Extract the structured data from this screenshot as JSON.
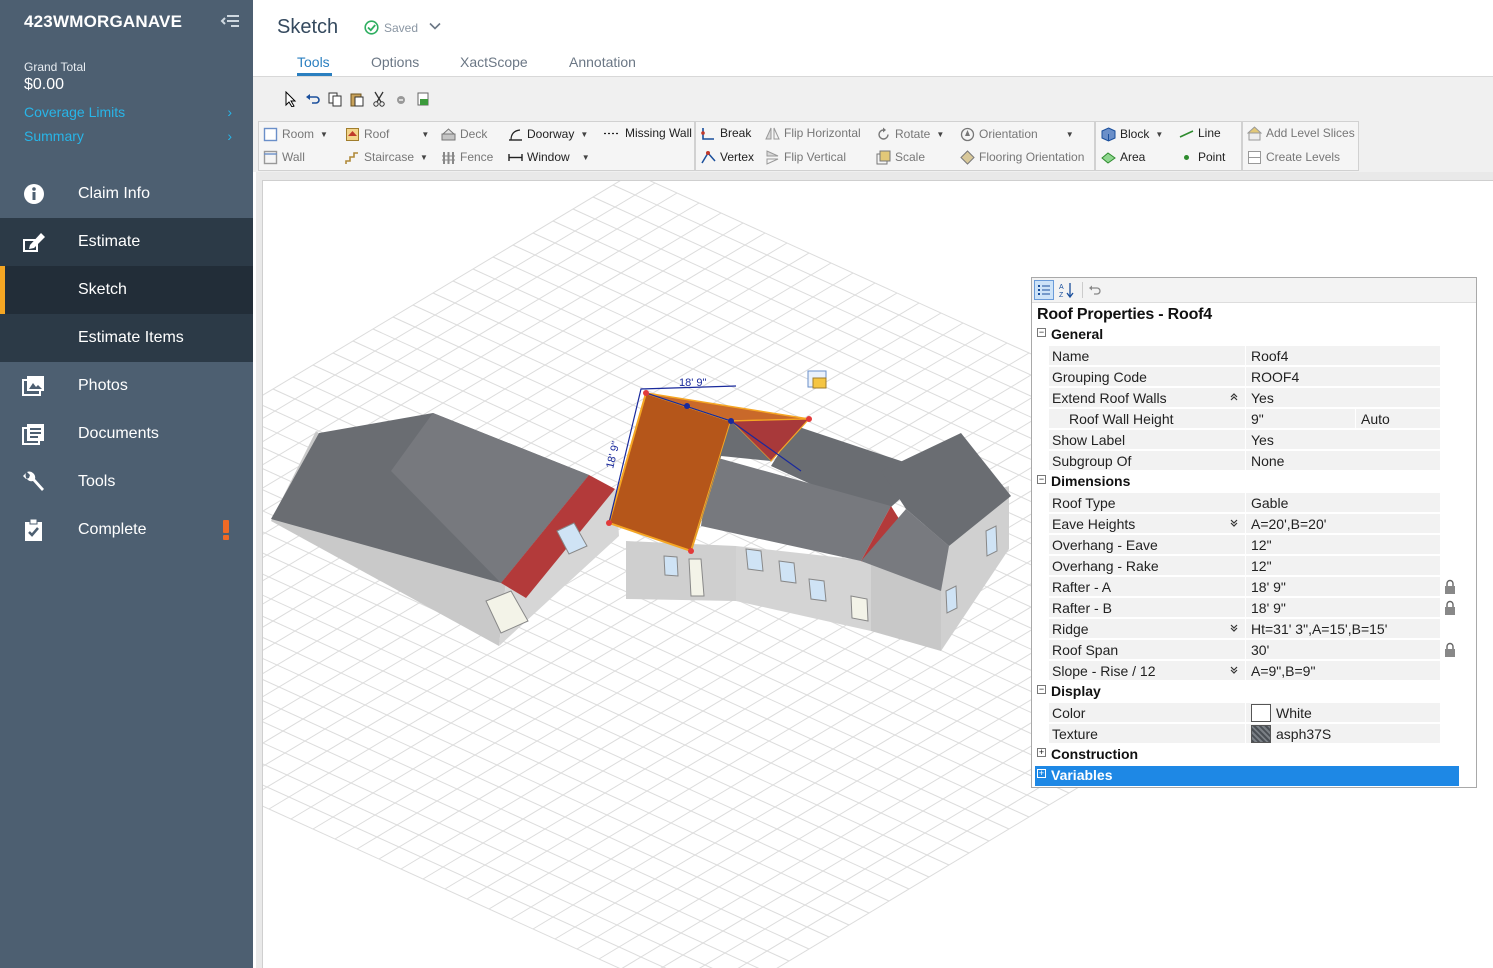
{
  "sidebar": {
    "claim_title": "423WMORGANAVE",
    "grand_total_label": "Grand Total",
    "grand_total_value": "$0.00",
    "links": [
      {
        "label": "Coverage Limits"
      },
      {
        "label": "Summary"
      }
    ],
    "nav": {
      "claim_info": "Claim Info",
      "estimate": "Estimate",
      "sketch": "Sketch",
      "estimate_items": "Estimate Items",
      "photos": "Photos",
      "documents": "Documents",
      "tools": "Tools",
      "complete": "Complete"
    }
  },
  "header": {
    "title": "Sketch",
    "saved": "Saved",
    "tabs": [
      "Tools",
      "Options",
      "XactScope",
      "Annotation"
    ]
  },
  "toolbar": {
    "room": "Room",
    "wall": "Wall",
    "roof": "Roof",
    "staircase": "Staircase",
    "deck": "Deck",
    "fence": "Fence",
    "doorway": "Doorway",
    "window": "Window",
    "missing_wall": "Missing Wall",
    "break": "Break",
    "vertex": "Vertex",
    "flip_horizontal": "Flip Horizontal",
    "flip_vertical": "Flip Vertical",
    "rotate": "Rotate",
    "scale": "Scale",
    "orientation": "Orientation",
    "flooring_orientation": "Flooring Orientation",
    "block": "Block",
    "area": "Area",
    "line": "Line",
    "point": "Point",
    "add_level_slices": "Add Level Slices",
    "create_levels": "Create Levels"
  },
  "canvas": {
    "dimension_top": "18' 9\"",
    "dimension_side": "18' 9\""
  },
  "properties": {
    "title": "Roof Properties - Roof4",
    "categories": {
      "general": "General",
      "dimensions": "Dimensions",
      "display": "Display",
      "construction": "Construction",
      "variables": "Variables"
    },
    "general": [
      {
        "name": "Name",
        "value": "Roof4"
      },
      {
        "name": "Grouping Code",
        "value": "ROOF4"
      },
      {
        "name": "Extend Roof Walls",
        "value": "Yes"
      },
      {
        "name": "Roof Wall Height",
        "value": "9\"",
        "value2": "Auto"
      },
      {
        "name": "Show Label",
        "value": "Yes"
      },
      {
        "name": "Subgroup Of",
        "value": "None"
      }
    ],
    "dimensions": [
      {
        "name": "Roof Type",
        "value": "Gable"
      },
      {
        "name": "Eave Heights",
        "value": "A=20',B=20'"
      },
      {
        "name": "Overhang - Eave",
        "value": "12\""
      },
      {
        "name": "Overhang - Rake",
        "value": "12\""
      },
      {
        "name": "Rafter - A",
        "value": "18' 9\""
      },
      {
        "name": "Rafter - B",
        "value": "18' 9\""
      },
      {
        "name": "Ridge",
        "value": "Ht=31' 3\",A=15',B=15'"
      },
      {
        "name": "Roof Span",
        "value": "30'"
      },
      {
        "name": "Slope - Rise / 12",
        "value": "A=9\",B=9\""
      }
    ],
    "display": [
      {
        "name": "Color",
        "value": "White",
        "swatch": "#ffffff"
      },
      {
        "name": "Texture",
        "value": "asph37S",
        "swatch": "#555a60"
      }
    ]
  },
  "colors": {
    "sidebar_bg": "#4d5f71",
    "sidebar_active": "#2c3a47",
    "accent_link": "#28b5e8",
    "selection_orange": "#f5a623",
    "alert": "#f06a25",
    "tab_active": "#2a7fc0",
    "selected_row": "#1e88e5",
    "roof_gray": "#6a6d72",
    "gable_red": "#b33a3a",
    "selected_roof": "#b5561a"
  }
}
